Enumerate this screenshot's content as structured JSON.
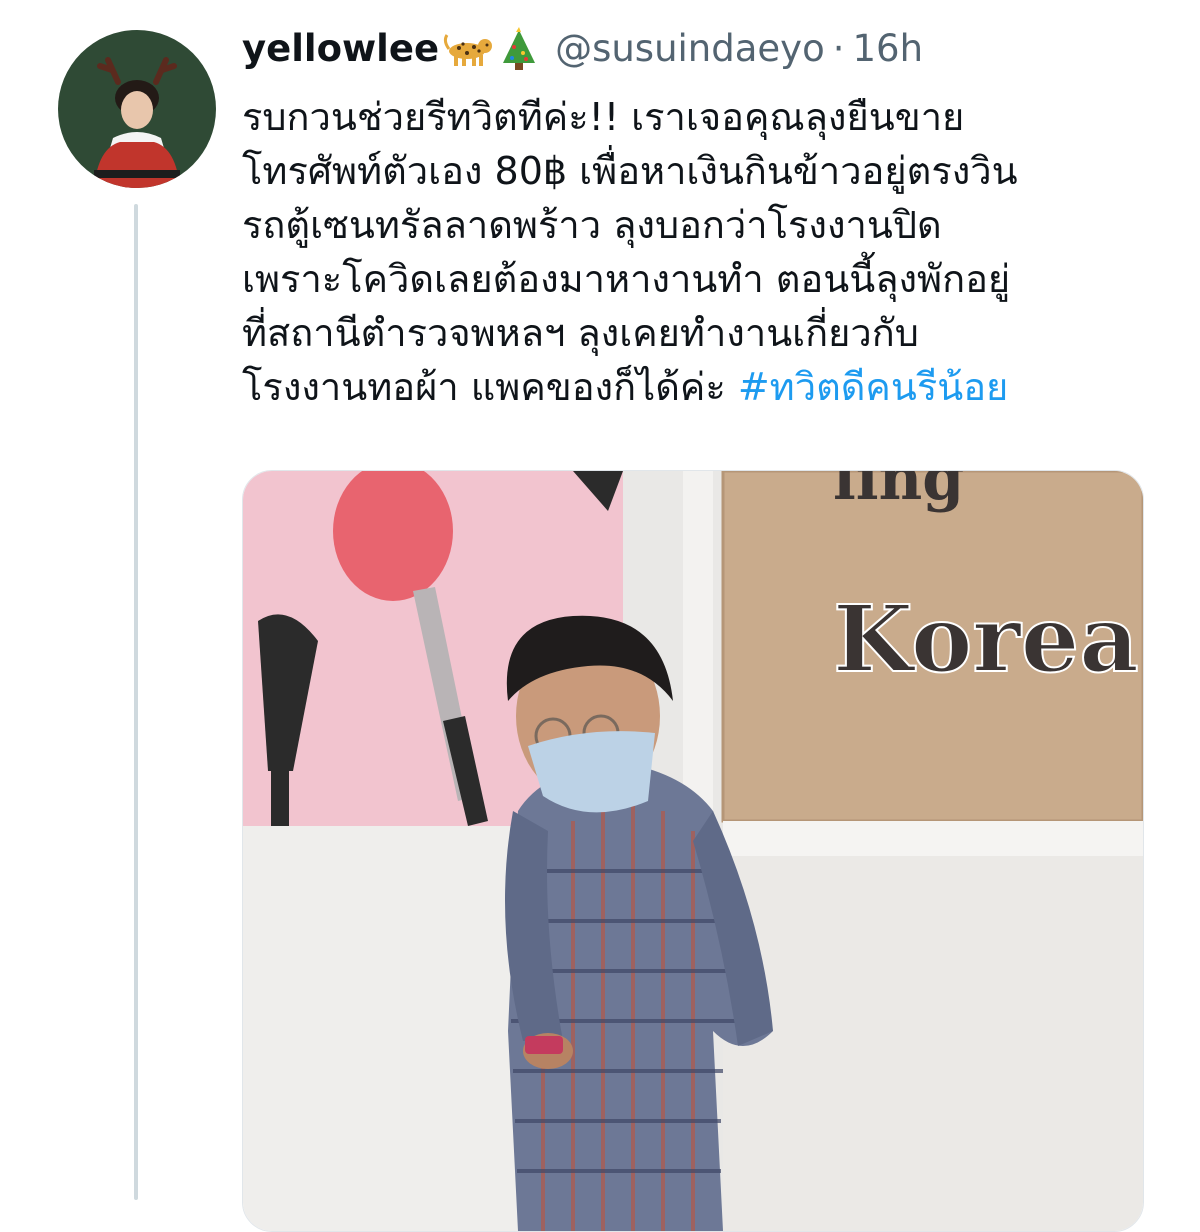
{
  "tweet": {
    "display_name": "yellowlee",
    "name_emojis": [
      "leopard-emoji",
      "christmas-tree-emoji"
    ],
    "handle": "@susuindaeyo",
    "separator": "·",
    "time": "16h",
    "text_lines": [
      "รบกวนช่วยรีทวิตทีค่ะ!! เราเจอคุณลุงยืนขาย",
      "โทรศัพท์ตัวเอง 80฿ เพื่อหาเงินกินข้าวอยู่ตรงวิน",
      "รถตู้เซนทรัลลาดพร้าว ลุงบอกว่าโรงงานปิด",
      "เพราะโควิดเลยต้องมาหางานทำ ตอนนี้ลุงพักอยู่",
      "ที่สถานีตำรวจพหลฯ ลุงเคยทำงานเกี่ยวกับ",
      "โรงงานทอผ้า แพคของก็ได้ค่ะ"
    ],
    "hashtag": "#ทวิตดีคนรีน้อย",
    "photo": {
      "sign_text": "Korea",
      "sign_partial_text": "ling"
    }
  },
  "colors": {
    "accent": "#1d9bf0",
    "secondary_text": "#536471",
    "avatar_bg": "#2f4a35",
    "wall_pink": "#f2c4cf"
  }
}
